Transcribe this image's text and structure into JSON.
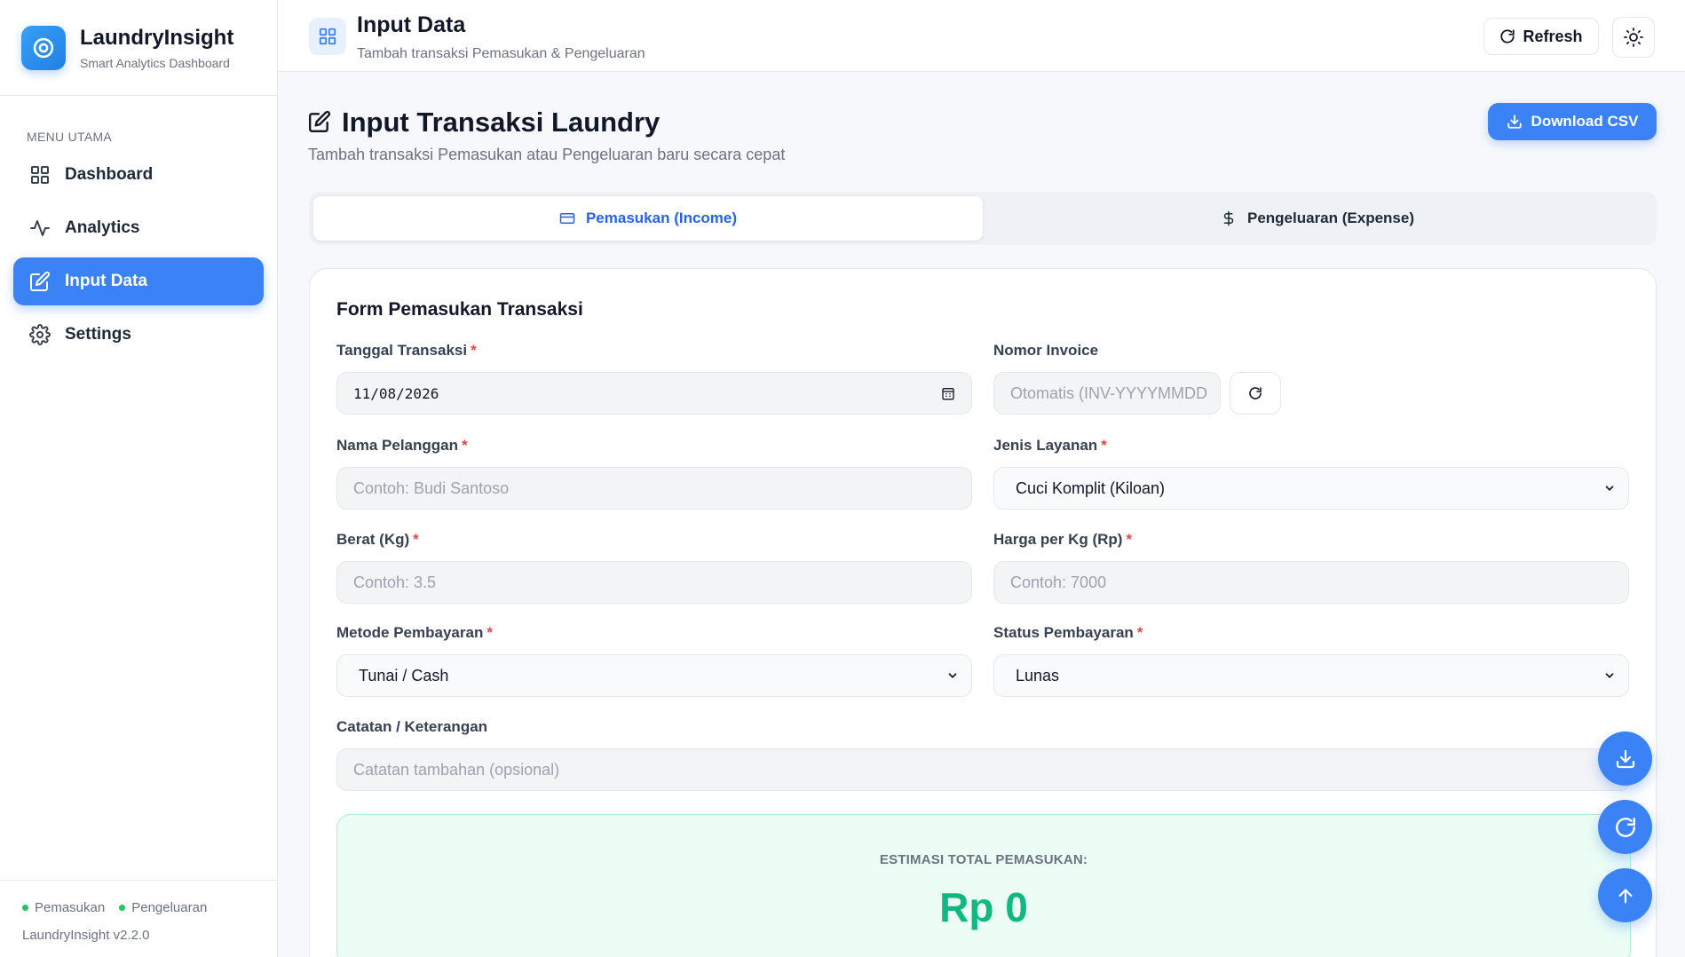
{
  "brand": {
    "name": "LaundryInsight",
    "subtitle": "Smart Analytics Dashboard"
  },
  "sidebar": {
    "section_label": "MENU UTAMA",
    "items": [
      {
        "label": "Dashboard",
        "icon": "grid-icon",
        "active": false
      },
      {
        "label": "Analytics",
        "icon": "activity-icon",
        "active": false
      },
      {
        "label": "Input Data",
        "icon": "edit-icon",
        "active": true
      },
      {
        "label": "Settings",
        "icon": "gear-icon",
        "active": false
      }
    ],
    "legend": [
      "Pemasukan",
      "Pengeluaran"
    ],
    "version": "LaundryInsight v2.2.0"
  },
  "topbar": {
    "title": "Input Data",
    "subtitle": "Tambah transaksi Pemasukan & Pengeluaran",
    "refresh_label": "Refresh"
  },
  "page": {
    "title": "Input Transaksi Laundry",
    "subtitle": "Tambah transaksi Pemasukan atau Pengeluaran baru secara cepat",
    "download_label": "Download CSV"
  },
  "tabs": [
    {
      "label": "Pemasukan (Income)",
      "active": true
    },
    {
      "label": "Pengeluaran (Expense)",
      "active": false
    }
  ],
  "form": {
    "title": "Form Pemasukan Transaksi",
    "date": {
      "label": "Tanggal Transaksi",
      "value": "11/08/2026"
    },
    "invoice": {
      "label": "Nomor Invoice",
      "placeholder": "Otomatis (INV-YYYYMMDD"
    },
    "customer": {
      "label": "Nama Pelanggan",
      "placeholder": "Contoh: Budi Santoso"
    },
    "service": {
      "label": "Jenis Layanan",
      "value": "Cuci Komplit (Kiloan)"
    },
    "weight": {
      "label": "Berat (Kg)",
      "placeholder": "Contoh: 3.5"
    },
    "price": {
      "label": "Harga per Kg (Rp)",
      "placeholder": "Contoh: 7000"
    },
    "payment_method": {
      "label": "Metode Pembayaran",
      "value": "Tunai / Cash"
    },
    "payment_status": {
      "label": "Status Pembayaran",
      "value": "Lunas"
    },
    "notes": {
      "label": "Catatan / Keterangan",
      "placeholder": "Catatan tambahan (opsional)"
    },
    "required_mark": "*"
  },
  "estimate": {
    "label": "ESTIMASI TOTAL PEMASUKAN:",
    "value": "Rp 0"
  },
  "colors": {
    "primary": "#3b82f6",
    "success": "#10b981",
    "required": "#ef4444"
  }
}
